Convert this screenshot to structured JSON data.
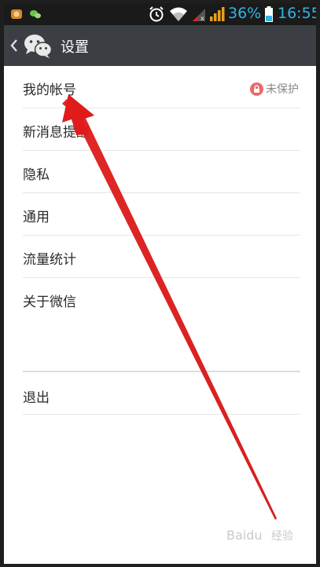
{
  "status_bar": {
    "battery_percent": "36%",
    "time": "16:55"
  },
  "app_bar": {
    "title": "设置"
  },
  "settings": {
    "items": [
      {
        "label": "我的帐号",
        "badge": "未保护"
      },
      {
        "label": "新消息提醒"
      },
      {
        "label": "隐私"
      },
      {
        "label": "通用"
      },
      {
        "label": "流量统计"
      },
      {
        "label": "关于微信"
      }
    ],
    "logout": "退出"
  },
  "watermark": {
    "brand": "Baidu",
    "suffix": "经验"
  },
  "colors": {
    "app_bar": "#3b3e43",
    "status_accent": "#30b4e6",
    "arrow": "#e01b1b",
    "lock_badge": "#e86a6a"
  }
}
